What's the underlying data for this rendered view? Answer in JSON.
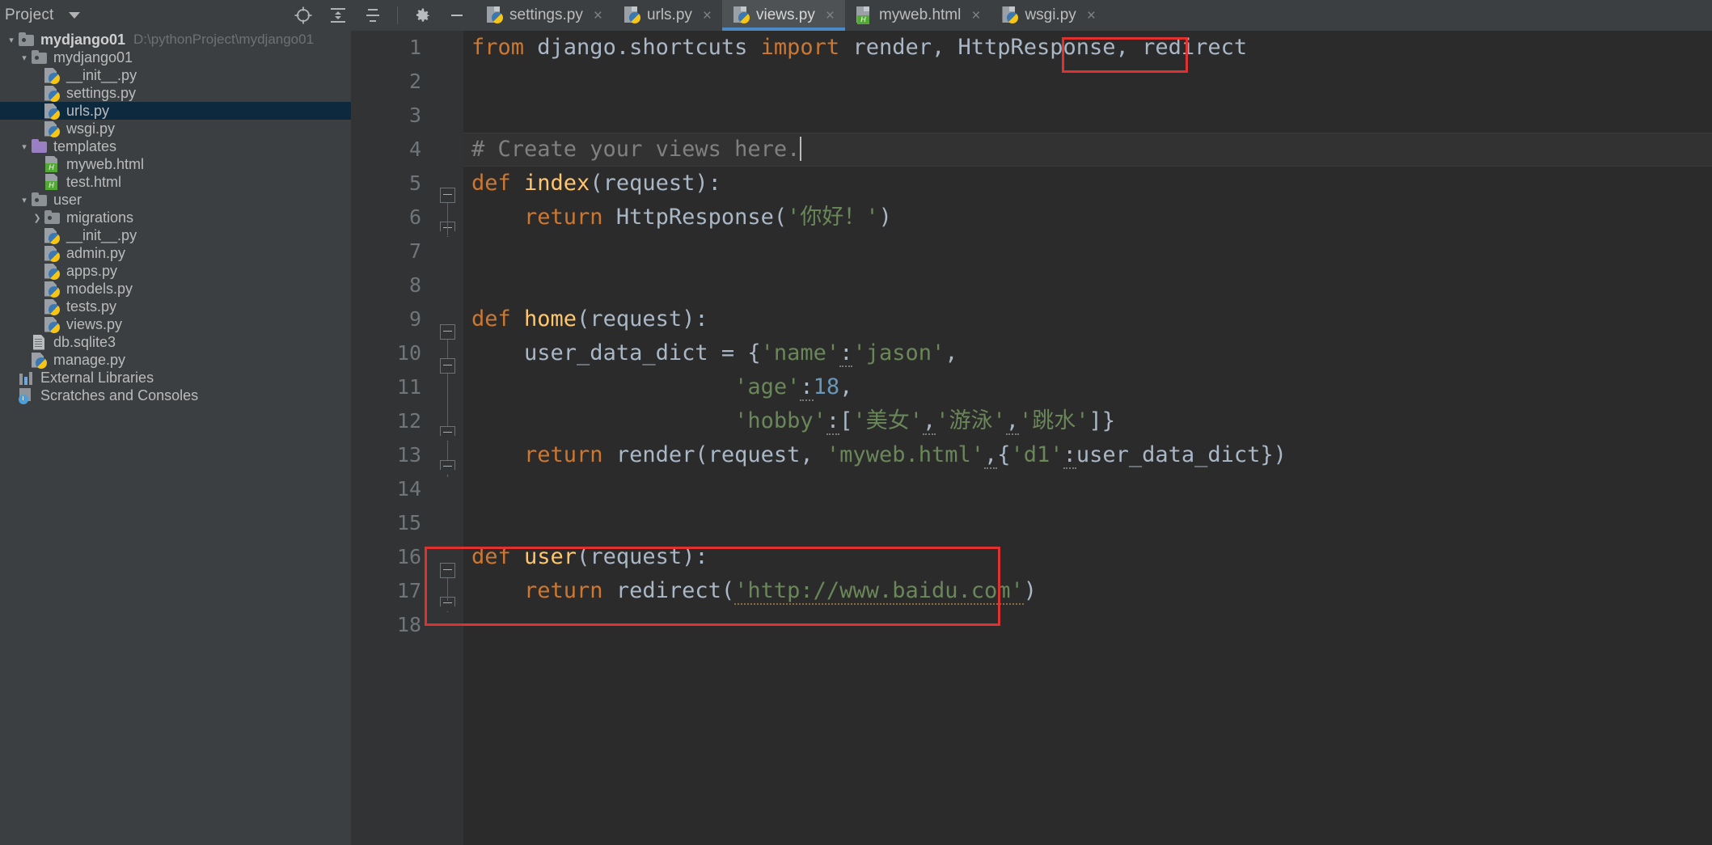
{
  "window": {
    "project_panel_title": "Project",
    "icons": {
      "locate": "crosshair-icon",
      "collapse_all": "collapse-all-icon",
      "expand_settings": "sort-icon",
      "settings": "gear-icon",
      "minimize": "minimize-icon",
      "dropdown": "chevron-down-icon"
    }
  },
  "project": {
    "root_name": "mydjango01",
    "root_path": "D:\\pythonProject\\mydjango01",
    "tree": [
      {
        "label": "mydjango01",
        "icon": "folder-icon",
        "indent": 1,
        "twist": "expanded",
        "selected": false
      },
      {
        "label": "__init__.py",
        "icon": "python-file-icon",
        "indent": 2,
        "twist": "",
        "selected": false
      },
      {
        "label": "settings.py",
        "icon": "python-file-icon",
        "indent": 2,
        "twist": "",
        "selected": false
      },
      {
        "label": "urls.py",
        "icon": "python-file-icon",
        "indent": 2,
        "twist": "",
        "selected": true
      },
      {
        "label": "wsgi.py",
        "icon": "python-file-icon",
        "indent": 2,
        "twist": "",
        "selected": false
      },
      {
        "label": "templates",
        "icon": "folder-purple-icon",
        "indent": 1,
        "twist": "expanded",
        "selected": false
      },
      {
        "label": "myweb.html",
        "icon": "html-file-icon",
        "indent": 2,
        "twist": "",
        "selected": false
      },
      {
        "label": "test.html",
        "icon": "html-file-icon",
        "indent": 2,
        "twist": "",
        "selected": false
      },
      {
        "label": "user",
        "icon": "folder-icon",
        "indent": 1,
        "twist": "expanded",
        "selected": false
      },
      {
        "label": "migrations",
        "icon": "folder-icon",
        "indent": 2,
        "twist": "collapsed",
        "selected": false
      },
      {
        "label": "__init__.py",
        "icon": "python-file-icon",
        "indent": 2,
        "twist": "",
        "selected": false
      },
      {
        "label": "admin.py",
        "icon": "python-file-icon",
        "indent": 2,
        "twist": "",
        "selected": false
      },
      {
        "label": "apps.py",
        "icon": "python-file-icon",
        "indent": 2,
        "twist": "",
        "selected": false
      },
      {
        "label": "models.py",
        "icon": "python-file-icon",
        "indent": 2,
        "twist": "",
        "selected": false
      },
      {
        "label": "tests.py",
        "icon": "python-file-icon",
        "indent": 2,
        "twist": "",
        "selected": false
      },
      {
        "label": "views.py",
        "icon": "python-file-icon",
        "indent": 2,
        "twist": "",
        "selected": false
      },
      {
        "label": "db.sqlite3",
        "icon": "db-file-icon",
        "indent": 1,
        "twist": "",
        "selected": false
      },
      {
        "label": "manage.py",
        "icon": "python-file-icon",
        "indent": 1,
        "twist": "",
        "selected": false
      },
      {
        "label": "External Libraries",
        "icon": "external-libraries-icon",
        "indent": 0,
        "twist": "",
        "selected": false
      },
      {
        "label": "Scratches and Consoles",
        "icon": "scratches-icon",
        "indent": 0,
        "twist": "",
        "selected": false
      }
    ]
  },
  "tabs": [
    {
      "label": "settings.py",
      "icon": "python-file-icon",
      "active": false
    },
    {
      "label": "urls.py",
      "icon": "python-file-icon",
      "active": false
    },
    {
      "label": "views.py",
      "icon": "python-file-icon",
      "active": true
    },
    {
      "label": "myweb.html",
      "icon": "html-file-icon",
      "active": false
    },
    {
      "label": "wsgi.py",
      "icon": "python-file-icon",
      "active": false
    }
  ],
  "editor": {
    "filename": "views.py",
    "close_glyph": "×",
    "line_numbers": [
      "1",
      "2",
      "3",
      "4",
      "5",
      "6",
      "7",
      "8",
      "9",
      "10",
      "11",
      "12",
      "13",
      "14",
      "15",
      "16",
      "17",
      "18"
    ],
    "caret_line": 4,
    "lines": {
      "l1_from": "from",
      "l1_module": " django.shortcuts ",
      "l1_import": "import",
      "l1_names": " render, HttpResponse, ",
      "l1_redirect": "redirect",
      "l4_comment": "# Create your views here.",
      "l5_def": "def",
      "l5_name": " index",
      "l5_args": "(request):",
      "l6_return": "return",
      "l6_call": " HttpResponse(",
      "l6_str": "'你好！'",
      "l6_close": ")",
      "l9_def": "def",
      "l9_name": " home",
      "l9_args": "(request):",
      "l10_var": "user_data_dict = {",
      "l10_key": "'name'",
      "l10_colon": ":",
      "l10_val": "'jason'",
      "l10_comma": ",",
      "l11_key": "'age'",
      "l11_colon": ":",
      "l11_val": "18",
      "l11_comma": ",",
      "l12_key": "'hobby'",
      "l12_colon": ":",
      "l12_open": "[",
      "l12_v1": "'美女'",
      "l12_c1": ",",
      "l12_v2": "'游泳'",
      "l12_c2": ",",
      "l12_v3": "'跳水'",
      "l12_close": "]}",
      "l13_return": "return",
      "l13_call": " render(request, ",
      "l13_tpl": "'myweb.html'",
      "l13_comma": ",",
      "l13_dict_open": "{",
      "l13_d1": "'d1'",
      "l13_dcolon": ":",
      "l13_dval": "user_data_dict",
      "l13_dclose": "})",
      "l16_def": "def",
      "l16_name": " user",
      "l16_args": "(request):",
      "l17_return": "return",
      "l17_call": " redirect(",
      "l17_url": "'http://www.baidu.com'",
      "l17_close": ")"
    },
    "gutter_run_icon": "html-run-icon",
    "gutter_run_icon_letter": "H"
  },
  "annotations": {
    "box1_target": "redirect",
    "box2_target": "user-function-block"
  },
  "colors": {
    "keyword": "#cc7832",
    "function": "#ffc66d",
    "identifier": "#a9b7c6",
    "string": "#6a8759",
    "number": "#6897bb",
    "comment": "#808080",
    "editor_bg": "#2b2b2b",
    "panel_bg": "#3c3f41",
    "selection": "#0d293e",
    "accent": "#4a88c7",
    "annotation_red": "#e03131"
  }
}
